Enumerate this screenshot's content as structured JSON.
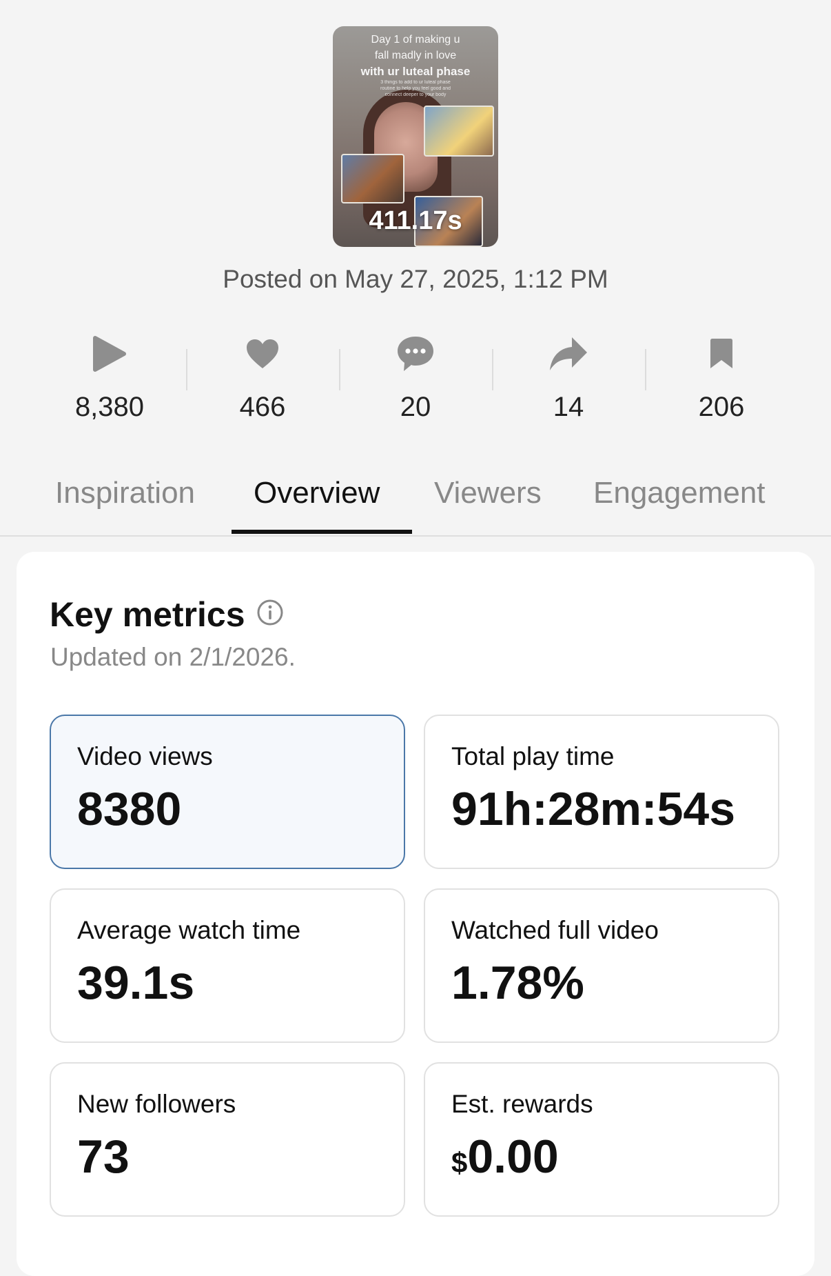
{
  "video": {
    "caption_line1": "Day 1 of making u",
    "caption_line2": "fall madly in love",
    "caption_line3": "with ur luteal phase",
    "caption_small1": "3 things to add to ur luteal phase",
    "caption_small2": "routine to help you feel good and",
    "caption_small3": "connect deeper to your body",
    "duration": "411.17s",
    "posted": "Posted on May 27, 2025, 1:12 PM"
  },
  "stats": [
    {
      "icon": "play-icon",
      "value": "8,380"
    },
    {
      "icon": "heart-icon",
      "value": "466"
    },
    {
      "icon": "comment-icon",
      "value": "20"
    },
    {
      "icon": "share-icon",
      "value": "14"
    },
    {
      "icon": "bookmark-icon",
      "value": "206"
    }
  ],
  "tabs": [
    {
      "label": "Inspiration",
      "active": false
    },
    {
      "label": "Overview",
      "active": true
    },
    {
      "label": "Viewers",
      "active": false
    },
    {
      "label": "Engagement",
      "active": false
    }
  ],
  "key_metrics": {
    "title": "Key metrics",
    "updated": "Updated on 2/1/2026.",
    "cards": [
      {
        "label": "Video views",
        "value": "8380",
        "selected": true
      },
      {
        "label": "Total play time",
        "value": "91h:28m:54s",
        "selected": false
      },
      {
        "label": "Average watch time",
        "value": "39.1s",
        "selected": false
      },
      {
        "label": "Watched full video",
        "value": "1.78%",
        "selected": false
      },
      {
        "label": "New followers",
        "value": "73",
        "selected": false
      },
      {
        "label": "Est. rewards",
        "currency": "$",
        "value": "0.00",
        "selected": false
      }
    ]
  },
  "colors": {
    "background": "#f4f4f4",
    "selected_card_bg": "#f5f8fc",
    "selected_card_border": "#4a77a8",
    "icon_gray": "#8e8e8e"
  }
}
